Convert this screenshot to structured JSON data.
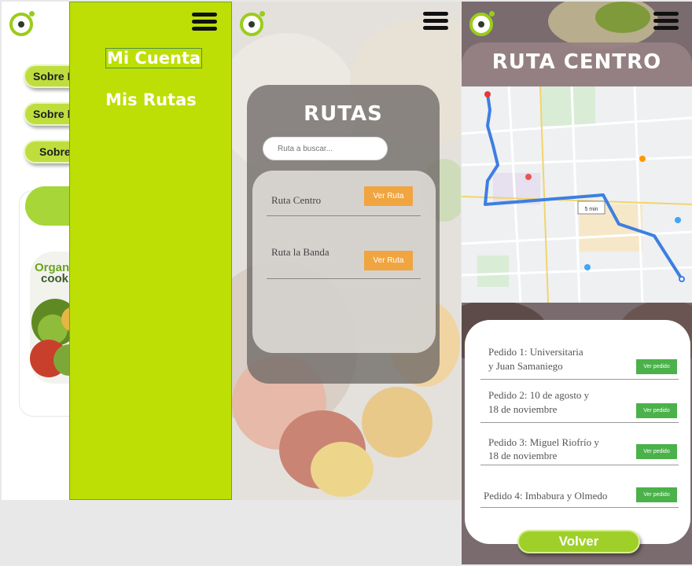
{
  "screen_menu": {
    "buttons": [
      "Sobre N",
      "Sobre l",
      "Sobre"
    ],
    "promo": {
      "line1": "Organ",
      "line2": "cook"
    },
    "menu_items": [
      {
        "label": "Mi Cuenta",
        "active": true
      },
      {
        "label": "Mis Rutas",
        "active": false
      }
    ]
  },
  "screen_rutas": {
    "title": "RUTAS",
    "search_placeholder": "Ruta a buscar...",
    "routes": [
      {
        "name": "Ruta Centro",
        "button": "Ver Ruta"
      },
      {
        "name": "Ruta la Banda",
        "button": "Ver Ruta"
      }
    ]
  },
  "screen_detalle": {
    "title": "RUTA CENTRO",
    "map_labels": [
      "5 min"
    ],
    "orders": [
      {
        "line1": "Pedido 1: Universitaria",
        "line2": "y Juan Samaniego",
        "button": "Ver pedido"
      },
      {
        "line1": "Pedido 2: 10 de agosto y",
        "line2": "18 de noviembre",
        "button": "Ver pedido"
      },
      {
        "line1": "Pedido 3: Miguel Riofrío y",
        "line2": "18 de noviembre",
        "button": "Ver pedido"
      },
      {
        "line1": "Pedido 4: Imbabura y Olmedo",
        "line2": "",
        "button": "Ver pedido"
      }
    ],
    "back_button": "Volver"
  },
  "colors": {
    "menu_green": "#bddf05",
    "accent_orange": "#f0a540",
    "button_green": "#4bb14a",
    "route_blue": "#3d7fe0"
  }
}
